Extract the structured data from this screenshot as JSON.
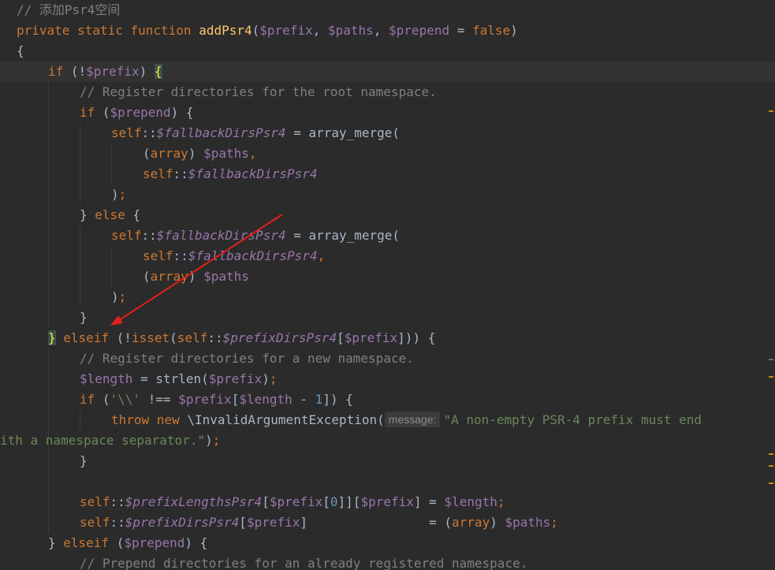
{
  "editor": {
    "lines": [
      {
        "tokens": [
          [
            "cmt",
            "// 添加Psr4空间"
          ]
        ]
      },
      {
        "tokens": [
          [
            "kw",
            "private static function "
          ],
          [
            "fn",
            "addPsr4"
          ],
          [
            "plain",
            "("
          ],
          [
            "var",
            "$prefix"
          ],
          [
            "plain",
            ", "
          ],
          [
            "var",
            "$paths"
          ],
          [
            "plain",
            ", "
          ],
          [
            "var",
            "$prepend"
          ],
          [
            "plain",
            " = "
          ],
          [
            "kw",
            "false"
          ],
          [
            "plain",
            ")"
          ]
        ]
      },
      {
        "tokens": [
          [
            "plain",
            "{"
          ]
        ]
      },
      {
        "tokens": [
          [
            "kw",
            "if "
          ],
          [
            "plain",
            "(!"
          ],
          [
            "var",
            "$prefix"
          ],
          [
            "plain",
            ") "
          ],
          [
            "brace",
            "{"
          ]
        ]
      },
      {
        "tokens": [
          [
            "cmt",
            "// Register directories for the root namespace."
          ]
        ]
      },
      {
        "tokens": [
          [
            "kw",
            "if "
          ],
          [
            "plain",
            "("
          ],
          [
            "var",
            "$prepend"
          ],
          [
            "plain",
            ") {"
          ]
        ]
      },
      {
        "tokens": [
          [
            "kw",
            "self"
          ],
          [
            "plain",
            "::"
          ],
          [
            "field",
            "$fallbackDirsPsr4"
          ],
          [
            "plain",
            " = array_merge("
          ]
        ]
      },
      {
        "tokens": [
          [
            "plain",
            "("
          ],
          [
            "kw",
            "array"
          ],
          [
            "plain",
            ") "
          ],
          [
            "var",
            "$paths"
          ],
          [
            "kw",
            ","
          ]
        ]
      },
      {
        "tokens": [
          [
            "kw",
            "self"
          ],
          [
            "plain",
            "::"
          ],
          [
            "field",
            "$fallbackDirsPsr4"
          ]
        ]
      },
      {
        "tokens": [
          [
            "plain",
            ")"
          ],
          [
            "kw",
            ";"
          ]
        ]
      },
      {
        "tokens": [
          [
            "plain",
            "} "
          ],
          [
            "kw",
            "else"
          ],
          [
            "plain",
            " {"
          ]
        ]
      },
      {
        "tokens": [
          [
            "kw",
            "self"
          ],
          [
            "plain",
            "::"
          ],
          [
            "field",
            "$fallbackDirsPsr4"
          ],
          [
            "plain",
            " = array_merge("
          ]
        ]
      },
      {
        "tokens": [
          [
            "kw",
            "self"
          ],
          [
            "plain",
            "::"
          ],
          [
            "field",
            "$fallbackDirsPsr4"
          ],
          [
            "kw",
            ","
          ]
        ]
      },
      {
        "tokens": [
          [
            "plain",
            "("
          ],
          [
            "kw",
            "array"
          ],
          [
            "plain",
            ") "
          ],
          [
            "var",
            "$paths"
          ]
        ]
      },
      {
        "tokens": [
          [
            "plain",
            ")"
          ],
          [
            "kw",
            ";"
          ]
        ]
      },
      {
        "tokens": [
          [
            "plain",
            "}"
          ]
        ]
      },
      {
        "tokens": [
          [
            "brace",
            "}"
          ],
          [
            "plain",
            " "
          ],
          [
            "kw",
            "elseif"
          ],
          [
            "plain",
            " (!"
          ],
          [
            "kw",
            "isset"
          ],
          [
            "plain",
            "("
          ],
          [
            "kw",
            "self"
          ],
          [
            "plain",
            "::"
          ],
          [
            "field",
            "$prefixDirsPsr4"
          ],
          [
            "plain",
            "["
          ],
          [
            "var",
            "$prefix"
          ],
          [
            "plain",
            "])) {"
          ]
        ]
      },
      {
        "tokens": [
          [
            "cmt",
            "// Register directories for a new namespace."
          ]
        ]
      },
      {
        "tokens": [
          [
            "var",
            "$length"
          ],
          [
            "plain",
            " = strlen("
          ],
          [
            "var",
            "$prefix"
          ],
          [
            "plain",
            ")"
          ],
          [
            "kw",
            ";"
          ]
        ]
      },
      {
        "tokens": [
          [
            "kw",
            "if "
          ],
          [
            "plain",
            "("
          ],
          [
            "str",
            "'\\\\'"
          ],
          [
            "plain",
            " !== "
          ],
          [
            "var",
            "$prefix"
          ],
          [
            "plain",
            "["
          ],
          [
            "var",
            "$length"
          ],
          [
            "plain",
            " - "
          ],
          [
            "num",
            "1"
          ],
          [
            "plain",
            "]) {"
          ]
        ]
      },
      {
        "tokens": [
          [
            "kw",
            "throw new "
          ],
          [
            "plain",
            "\\InvalidArgumentException("
          ],
          [
            "hint",
            "message:"
          ],
          [
            "str",
            "\"A non-empty PSR-4 prefix must end"
          ]
        ]
      },
      {
        "tokens": [
          [
            "str",
            "ith a namespace separator.\""
          ],
          [
            "plain",
            ")"
          ],
          [
            "kw",
            ";"
          ]
        ]
      },
      {
        "tokens": [
          [
            "plain",
            "}"
          ]
        ]
      },
      {
        "tokens": []
      },
      {
        "tokens": [
          [
            "kw",
            "self"
          ],
          [
            "plain",
            "::"
          ],
          [
            "field",
            "$prefixLengthsPsr4"
          ],
          [
            "plain",
            "["
          ],
          [
            "var",
            "$prefix"
          ],
          [
            "plain",
            "["
          ],
          [
            "num",
            "0"
          ],
          [
            "plain",
            "]]["
          ],
          [
            "var",
            "$prefix"
          ],
          [
            "plain",
            "] = "
          ],
          [
            "var",
            "$length"
          ],
          [
            "kw",
            ";"
          ]
        ]
      },
      {
        "tokens": [
          [
            "kw",
            "self"
          ],
          [
            "plain",
            "::"
          ],
          [
            "field",
            "$prefixDirsPsr4"
          ],
          [
            "plain",
            "["
          ],
          [
            "var",
            "$prefix"
          ],
          [
            "plain",
            "]                = ("
          ],
          [
            "kw",
            "array"
          ],
          [
            "plain",
            ") "
          ],
          [
            "var",
            "$paths"
          ],
          [
            "kw",
            ";"
          ]
        ]
      },
      {
        "tokens": [
          [
            "plain",
            "} "
          ],
          [
            "kw",
            "elseif"
          ],
          [
            "plain",
            " ("
          ],
          [
            "var",
            "$prepend"
          ],
          [
            "plain",
            ") {"
          ]
        ]
      },
      {
        "tokens": [
          [
            "cmt",
            "// Prepend directories for an already registered namespace."
          ]
        ]
      }
    ]
  },
  "colors": {
    "background": "#2b2b2b",
    "current_line": "#323232",
    "keyword": "#cc7832",
    "function": "#ffc66d",
    "variable": "#9876aa",
    "comment": "#808080",
    "string": "#6a8759",
    "number": "#6897bb",
    "annotation_arrow": "#e0201b"
  }
}
